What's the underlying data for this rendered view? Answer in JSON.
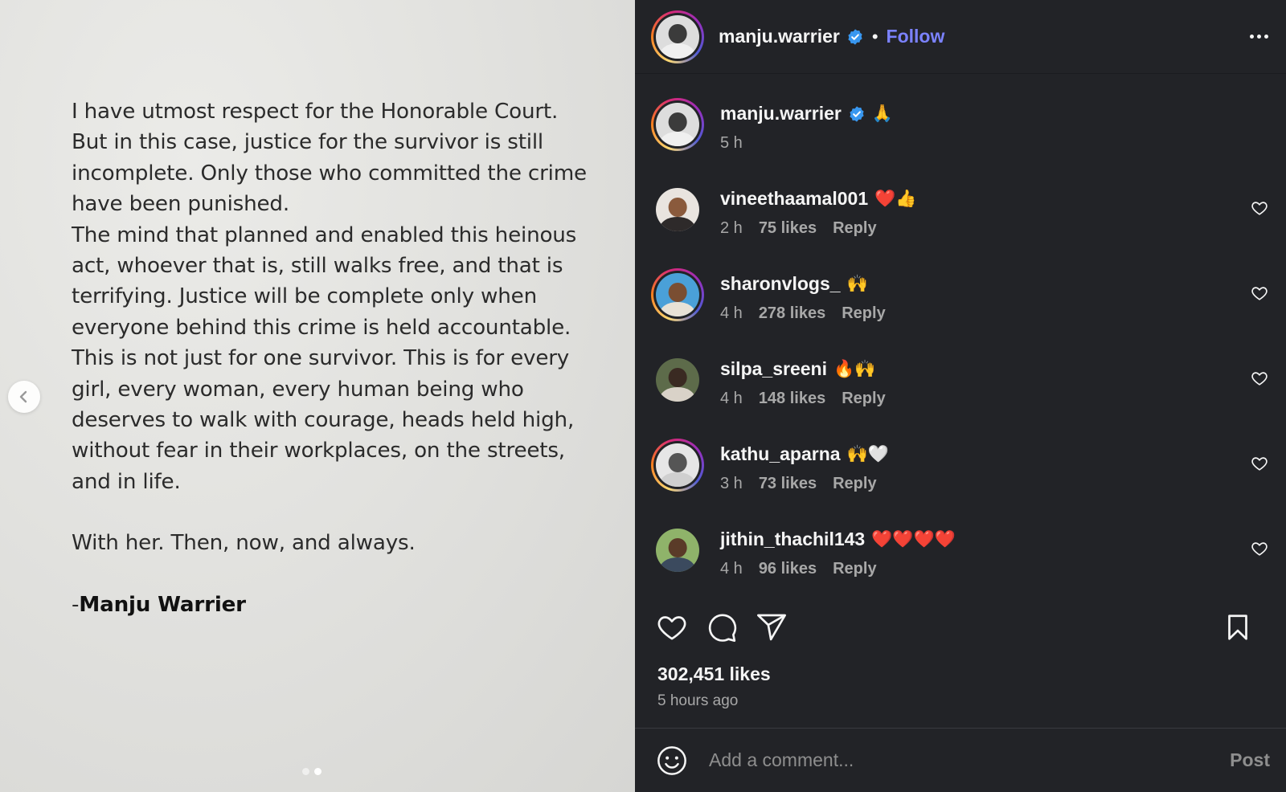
{
  "post_image": {
    "lines": [
      "I have utmost respect for the Honorable Court.",
      "But in this case, justice for the survivor is still",
      "incomplete. Only those who committed the crime",
      "have been punished.",
      "The mind that planned and enabled this heinous",
      "act, whoever that is, still walks free, and that is",
      "terrifying. Justice will be complete only when",
      "everyone behind this crime is held accountable.",
      "This is not just for one survivor. This is for every",
      "girl, every woman, every human being who",
      "deserves to walk with courage, heads held high,",
      "without fear in their workplaces, on the streets,",
      "and in life."
    ],
    "closing": "With her. Then, now, and always.",
    "signature_dash": "-",
    "signature": "Manju Warrier",
    "carousel_total": 2,
    "carousel_active": 2
  },
  "header": {
    "username": "manju.warrier",
    "separator": "•",
    "follow_label": "Follow"
  },
  "caption": {
    "username": "manju.warrier",
    "text": "🙏",
    "time": "5 h"
  },
  "comments": [
    {
      "username": "vineethaamal001",
      "text": "❤️👍",
      "time": "2 h",
      "likes": "75 likes",
      "reply": "Reply"
    },
    {
      "username": "sharonvlogs_",
      "text": "🙌",
      "time": "4 h",
      "likes": "278 likes",
      "reply": "Reply"
    },
    {
      "username": "silpa_sreeni",
      "text": "🔥🙌",
      "time": "4 h",
      "likes": "148 likes",
      "reply": "Reply"
    },
    {
      "username": "kathu_aparna",
      "text": "🙌🤍",
      "time": "3 h",
      "likes": "73 likes",
      "reply": "Reply"
    },
    {
      "username": "jithin_thachil143",
      "text": "❤️❤️❤️❤️",
      "time": "4 h",
      "likes": "96 likes",
      "reply": "Reply"
    }
  ],
  "stats": {
    "likes": "302,451 likes",
    "posted": "5 hours ago"
  },
  "composer": {
    "placeholder": "Add a comment...",
    "post_label": "Post"
  },
  "colors": {
    "panel_bg": "#222327",
    "follow_blue": "#7b82ff",
    "verified_blue": "#3897f0",
    "muted": "#a8a8a8"
  },
  "icons": [
    "chevron-left-icon",
    "verified-badge-icon",
    "more-options-icon",
    "heart-icon",
    "comment-icon",
    "share-icon",
    "bookmark-icon",
    "emoji-icon"
  ]
}
